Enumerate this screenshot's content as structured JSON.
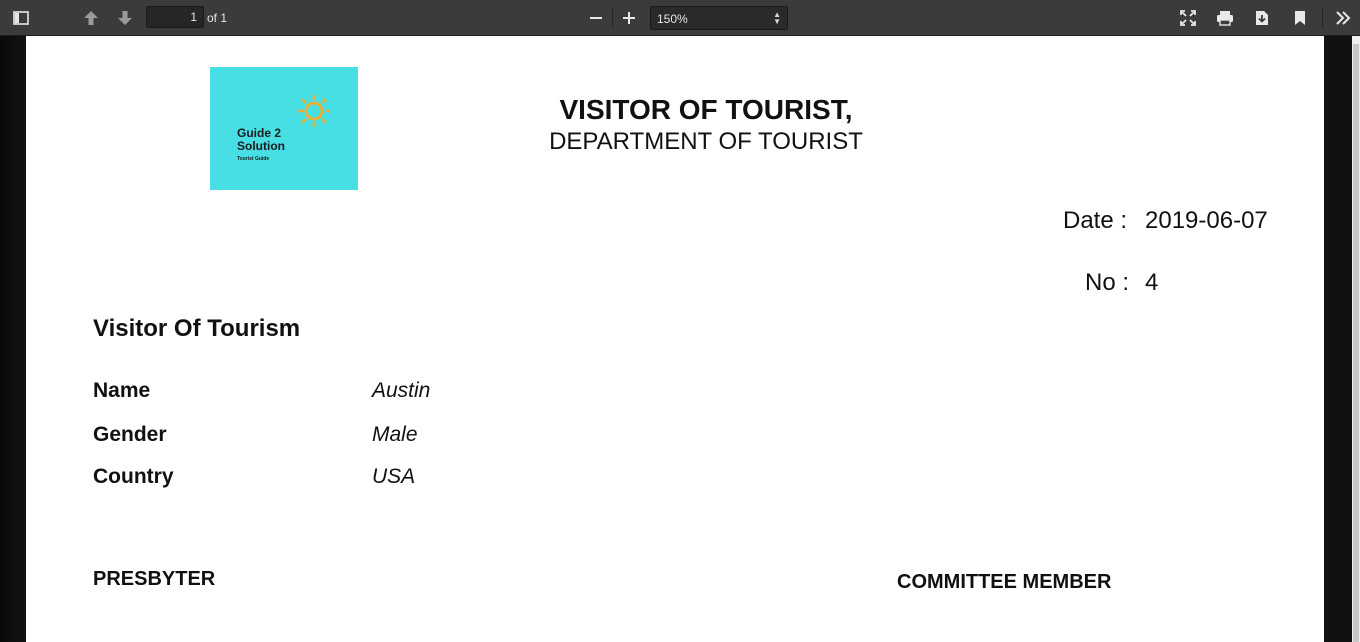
{
  "toolbar": {
    "page_current": "1",
    "page_total_label": "of 1",
    "zoom": "150%"
  },
  "document": {
    "logo": {
      "line1": "Guide 2",
      "line2": "Solution",
      "tagline": "Tourist Guide"
    },
    "title": "VISITOR OF TOURIST,",
    "subtitle": "DEPARTMENT OF TOURIST",
    "date_label": "Date :",
    "date_value": "2019-06-07",
    "no_label": "No :",
    "no_value": "4",
    "section_title": "Visitor Of Tourism",
    "fields": [
      {
        "label": "Name",
        "value": "Austin"
      },
      {
        "label": "Gender",
        "value": "Male"
      },
      {
        "label": "Country",
        "value": "USA"
      }
    ],
    "signatures": {
      "left": "PRESBYTER",
      "right": "COMMITTEE MEMBER"
    }
  }
}
